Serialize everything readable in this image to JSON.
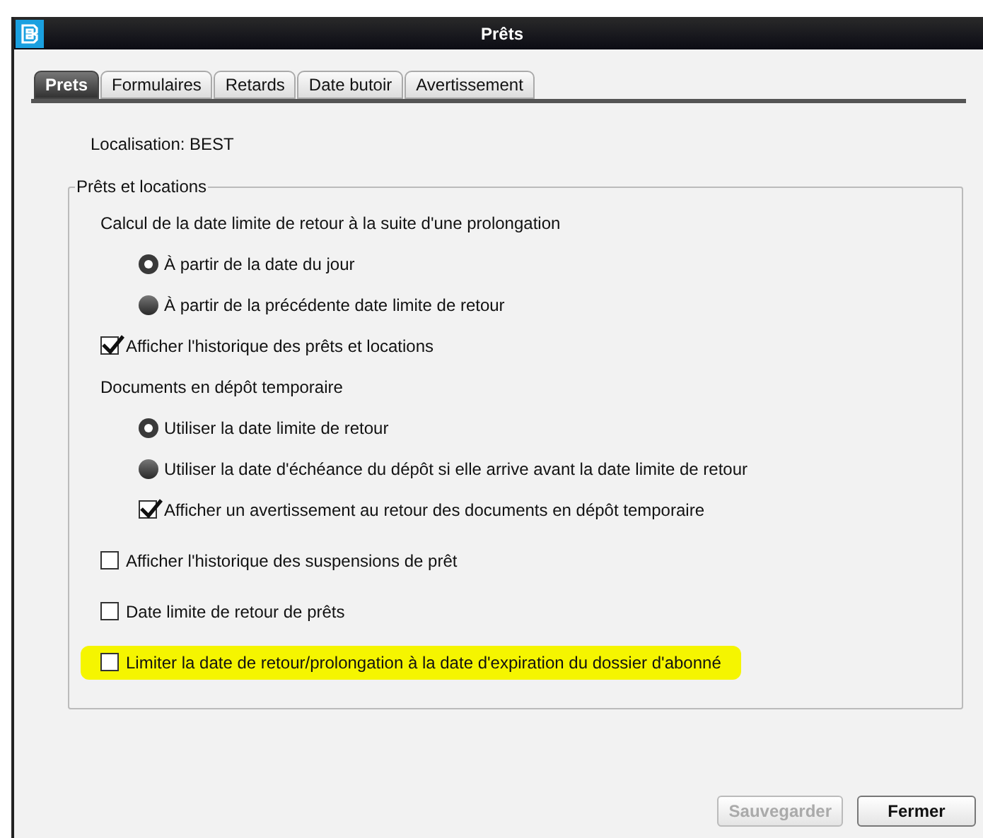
{
  "window": {
    "title": "Prêts"
  },
  "tabs": [
    {
      "label": "Prets",
      "selected": true
    },
    {
      "label": "Formulaires",
      "selected": false
    },
    {
      "label": "Retards",
      "selected": false
    },
    {
      "label": "Date butoir",
      "selected": false
    },
    {
      "label": "Avertissement",
      "selected": false
    }
  ],
  "location": "Localisation: BEST",
  "group": {
    "title": "Prêts et locations",
    "items": [
      {
        "kind": "heading",
        "text": "Calcul de la date limite de retour à la suite d'une prolongation",
        "children": [
          {
            "kind": "radio",
            "text": "À partir de la date du jour",
            "selected": true
          },
          {
            "kind": "radio",
            "text": "À partir de la précédente date limite de retour",
            "selected": false
          }
        ]
      },
      {
        "kind": "checkbox",
        "text": "Afficher l'historique des prêts et locations",
        "checked": true,
        "highlighted": false
      },
      {
        "kind": "heading",
        "text": "Documents en dépôt temporaire",
        "children": [
          {
            "kind": "radio",
            "text": "Utiliser la date limite de retour",
            "selected": true
          },
          {
            "kind": "radio",
            "text": "Utiliser la date d'échéance du dépôt si elle arrive avant la date limite de retour",
            "selected": false
          },
          {
            "kind": "checkbox",
            "text": "Afficher un avertissement au retour des documents en dépôt temporaire",
            "checked": true,
            "highlighted": false
          }
        ]
      },
      {
        "kind": "checkbox",
        "text": "Afficher l'historique des suspensions de prêt",
        "checked": false,
        "highlighted": false
      },
      {
        "kind": "checkbox",
        "text": "Date limite de retour de prêts",
        "checked": false,
        "highlighted": false
      },
      {
        "kind": "checkbox",
        "text": "Limiter la date de retour/prolongation à la date d'expiration du dossier d'abonné",
        "checked": false,
        "highlighted": true
      }
    ]
  },
  "buttons": [
    {
      "label": "Sauvegarder",
      "disabled": true
    },
    {
      "label": "Fermer",
      "disabled": false
    }
  ]
}
